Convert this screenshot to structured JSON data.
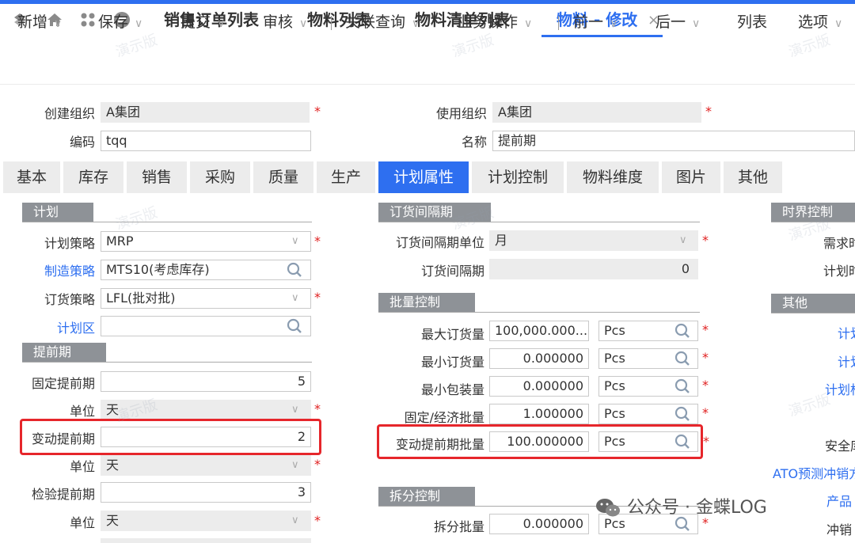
{
  "tabs": [
    {
      "label": "销售订单列表"
    },
    {
      "label": "物料列表"
    },
    {
      "label": "物料清单列表"
    },
    {
      "label": "物料 - 修改"
    }
  ],
  "toolbar": {
    "items": [
      "新增",
      "保存",
      "提交",
      "审核",
      "关联查询",
      "业务操作",
      "前一",
      "后一",
      "列表",
      "选项"
    ]
  },
  "header": {
    "create_org_label": "创建组织",
    "create_org_value": "A集团",
    "use_org_label": "使用组织",
    "use_org_value": "A集团",
    "code_label": "编码",
    "code_value": "tqq",
    "name_label": "名称",
    "name_value": "提前期"
  },
  "main_tabs": [
    "基本",
    "库存",
    "销售",
    "采购",
    "质量",
    "生产",
    "计划属性",
    "计划控制",
    "物料维度",
    "图片",
    "其他"
  ],
  "plan": {
    "title": "计划",
    "strategy_label": "计划策略",
    "strategy_value": "MRP",
    "mfg_label": "制造策略",
    "mfg_value": "MTS10(考虑库存)",
    "order_label": "订货策略",
    "order_value": "LFL(批对批)",
    "zone_label": "计划区",
    "zone_value": ""
  },
  "leadtime": {
    "title": "提前期",
    "fixed_label": "固定提前期",
    "fixed_value": "5",
    "unit1_label": "单位",
    "unit1_value": "天",
    "variable_label": "变动提前期",
    "variable_value": "2",
    "unit2_label": "单位",
    "unit2_value": "天",
    "inspect_label": "检验提前期",
    "inspect_value": "3",
    "unit3_label": "单位",
    "unit3_value": "天"
  },
  "order_interval": {
    "title": "订货间隔期",
    "unit_label": "订货间隔期单位",
    "unit_value": "月",
    "interval_label": "订货间隔期",
    "interval_value": "0"
  },
  "batch": {
    "title": "批量控制",
    "rows": [
      {
        "label": "最大订货量",
        "value": "100,000.000...",
        "unit": "Pcs"
      },
      {
        "label": "最小订货量",
        "value": "0.000000",
        "unit": "Pcs"
      },
      {
        "label": "最小包装量",
        "value": "0.000000",
        "unit": "Pcs"
      },
      {
        "label": "固定/经济批量",
        "value": "1.000000",
        "unit": "Pcs"
      },
      {
        "label": "变动提前期批量",
        "value": "100.000000",
        "unit": "Pcs"
      }
    ]
  },
  "split": {
    "title": "拆分控制",
    "qty_label": "拆分批量",
    "qty_value": "0.000000",
    "qty_unit": "Pcs"
  },
  "right": {
    "time_fence_title": "时界控制",
    "demand_label": "需求时",
    "plan_label": "计划时",
    "other_title": "其他",
    "plan1_label": "计划",
    "plan2_label": "计划",
    "plan3_label": "计划标",
    "safety_label": "安全库",
    "ato_label": "ATO预测冲销方",
    "product_label": "产品",
    "offset_label": "冲销"
  },
  "watermark": "演示版",
  "footer": "公众号 · 金蝶LOG"
}
